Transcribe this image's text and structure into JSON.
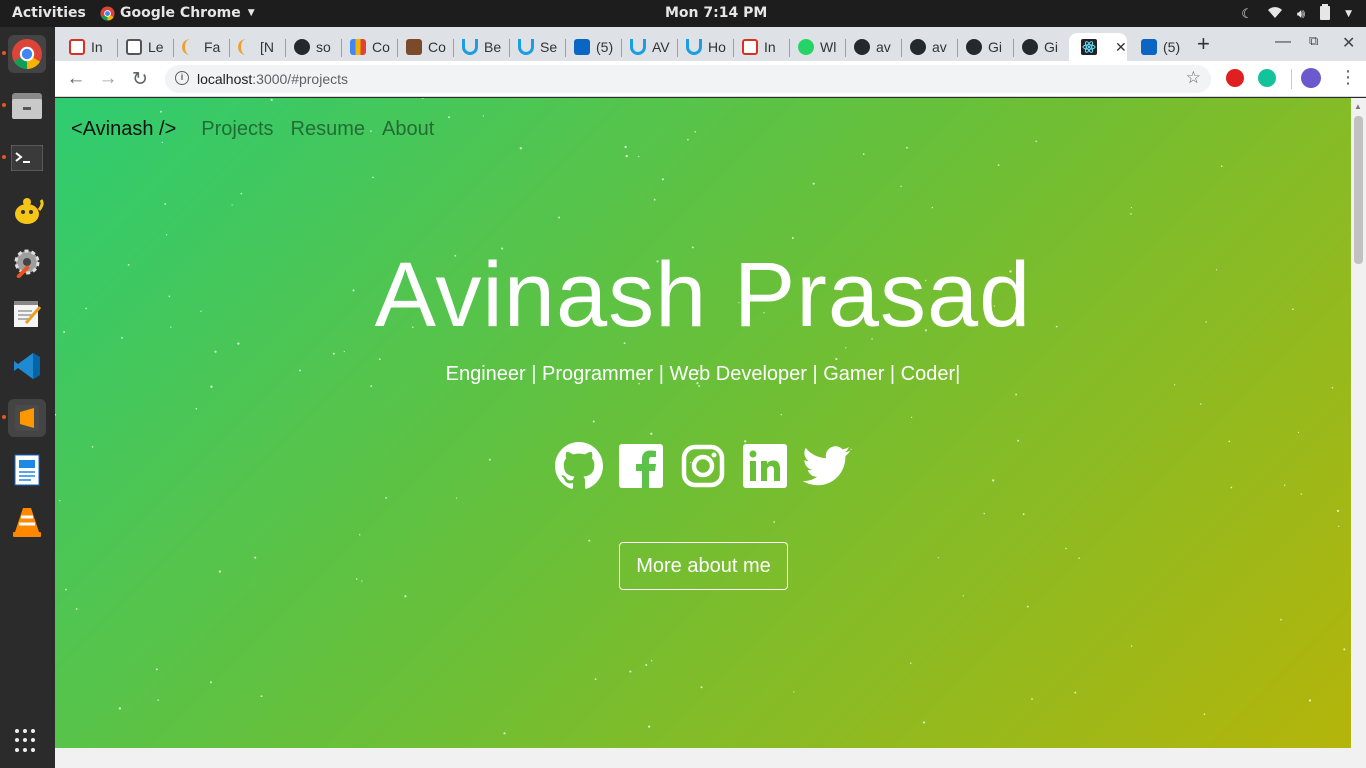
{
  "system": {
    "activities": "Activities",
    "app_name": "Google Chrome",
    "clock": "Mon  7:14 PM"
  },
  "dock": {
    "apps": [
      "chrome-icon",
      "file-manager-icon",
      "terminal-icon",
      "teapot-icon",
      "settings-icon",
      "text-editor-icon",
      "vscode-icon",
      "sublime-icon",
      "writer-icon",
      "vlc-icon"
    ]
  },
  "browser": {
    "tabs": [
      {
        "label": "In",
        "icon": "gmail-icon",
        "color": "#d93025"
      },
      {
        "label": "Le",
        "icon": "leetcode-icon",
        "color": "#555555"
      },
      {
        "label": "Fa",
        "icon": "gfg-icon",
        "color": "#f0a030"
      },
      {
        "label": "[N",
        "icon": "gfg-icon",
        "color": "#f0a030"
      },
      {
        "label": "so",
        "icon": "github-icon",
        "color": "#24292e"
      },
      {
        "label": "Co",
        "icon": "chart-icon",
        "color": "#4285f4"
      },
      {
        "label": "Co",
        "icon": "cc-icon",
        "color": "#7b4a2a"
      },
      {
        "label": "Be",
        "icon": "udemy-icon",
        "color": "#1a9ee0"
      },
      {
        "label": "Se",
        "icon": "udemy-icon",
        "color": "#1a9ee0"
      },
      {
        "label": "(5)",
        "icon": "linkedin-icon",
        "color": "#0a66c2"
      },
      {
        "label": "AV",
        "icon": "udemy-icon",
        "color": "#1a9ee0"
      },
      {
        "label": "Ho",
        "icon": "udemy-icon",
        "color": "#1a9ee0"
      },
      {
        "label": "In",
        "icon": "gmail-icon",
        "color": "#d93025"
      },
      {
        "label": "Wl",
        "icon": "whatsapp-icon",
        "color": "#25d366"
      },
      {
        "label": "av",
        "icon": "github-icon",
        "color": "#24292e"
      },
      {
        "label": "av",
        "icon": "github-icon",
        "color": "#24292e"
      },
      {
        "label": "Gi",
        "icon": "github-icon",
        "color": "#24292e"
      },
      {
        "label": "Gi",
        "icon": "github-icon",
        "color": "#24292e"
      },
      {
        "label": "",
        "icon": "react-icon",
        "color": "#222222",
        "active": true
      },
      {
        "label": "(5)",
        "icon": "linkedin-icon",
        "color": "#0a66c2"
      }
    ],
    "url_host": "localhost",
    "url_path": ":3000/#projects"
  },
  "site": {
    "brand": "<Avinash />",
    "nav": [
      "Projects",
      "Resume",
      "About"
    ],
    "name": "Avinash Prasad",
    "tagline": "Engineer | Programmer | Web Developer | Gamer | Coder|",
    "socials": [
      "github-icon",
      "facebook-icon",
      "instagram-icon",
      "linkedin-icon",
      "twitter-icon"
    ],
    "cta": "More about me"
  }
}
